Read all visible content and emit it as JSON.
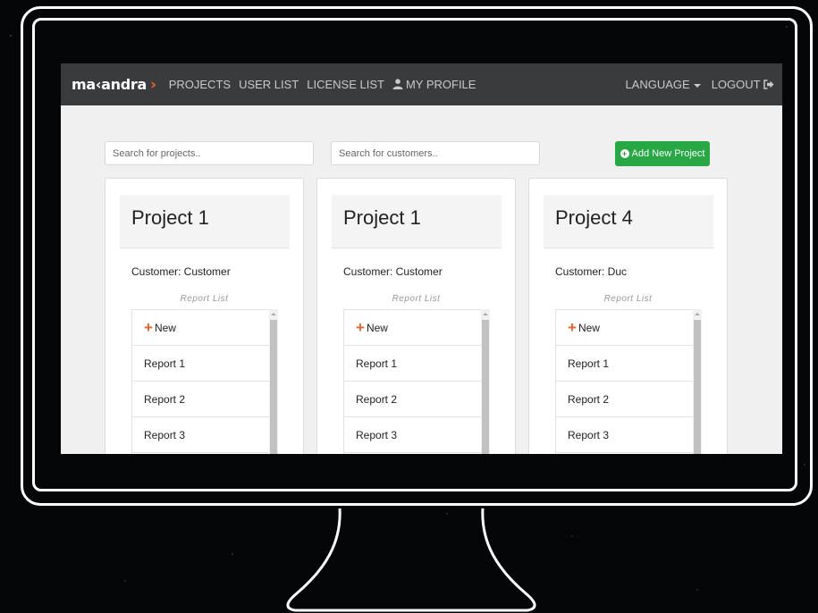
{
  "navbar": {
    "logo": "ma‹andra",
    "items": [
      "PROJECTS",
      "USER LIST",
      "LICENSE LIST"
    ],
    "profile": "MY PROFILE",
    "language": "LANGUAGE",
    "logout": "LOGOUT"
  },
  "search": {
    "projects_placeholder": "Search for projects..",
    "customers_placeholder": "Search for customers.."
  },
  "add_button": "Add New Project",
  "projects": [
    {
      "title": "Project 1",
      "customer": "Customer: Customer",
      "report_list_label": "Report List",
      "new_label": "New",
      "reports": [
        "Report 1",
        "Report 2",
        "Report 3"
      ]
    },
    {
      "title": "Project 1",
      "customer": "Customer: Customer",
      "report_list_label": "Report List",
      "new_label": "New",
      "reports": [
        "Report 1",
        "Report 2",
        "Report 3"
      ]
    },
    {
      "title": "Project 4",
      "customer": "Customer: Duc",
      "report_list_label": "Report List",
      "new_label": "New",
      "reports": [
        "Report 1",
        "Report 2",
        "Report 3"
      ]
    }
  ],
  "colors": {
    "navbar": "#3a3b3d",
    "accent": "#e8632b",
    "button": "#28a745",
    "page_background": "#f0f0f0"
  }
}
